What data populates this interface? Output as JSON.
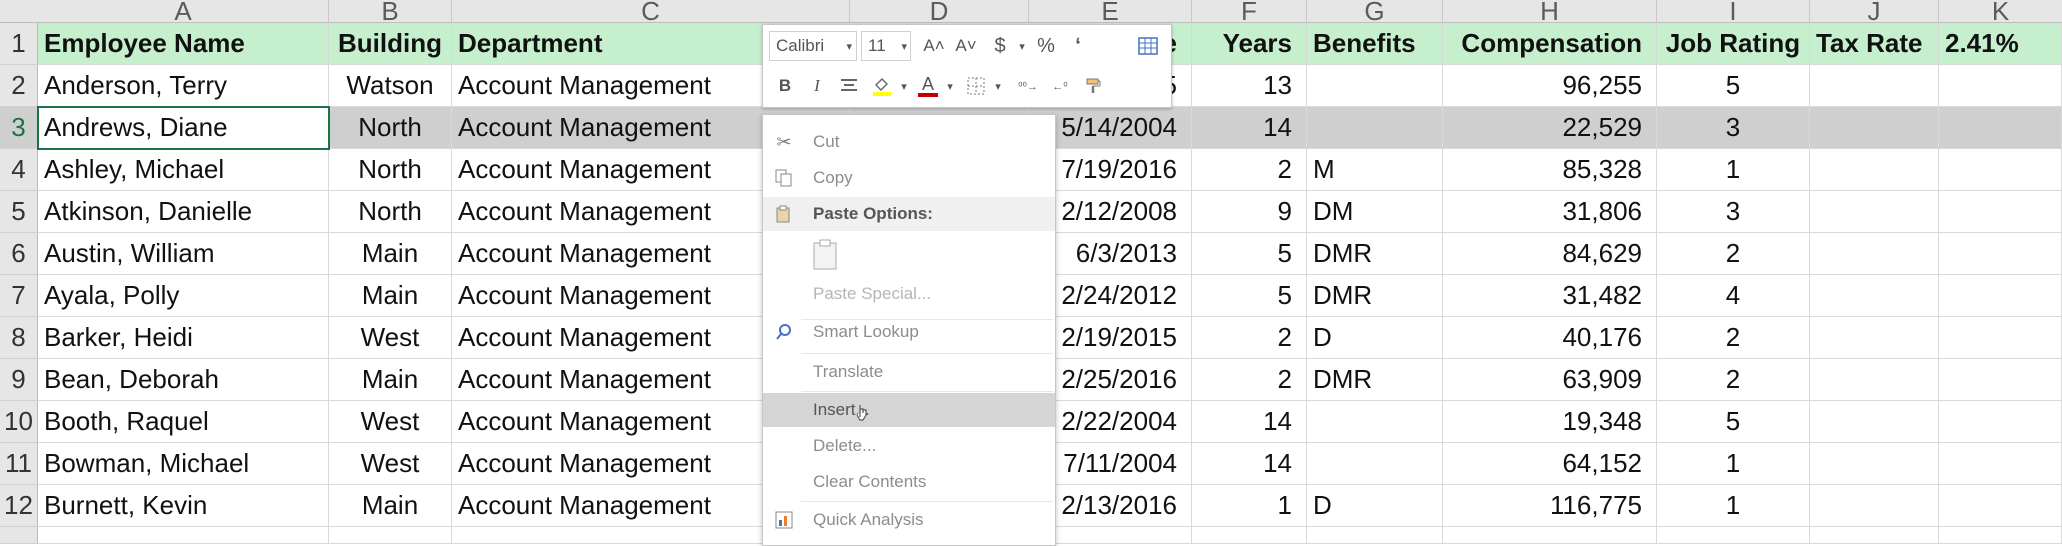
{
  "columns": [
    "A",
    "B",
    "C",
    "D",
    "E",
    "F",
    "G",
    "H",
    "I",
    "J",
    "K"
  ],
  "rows": [
    "1",
    "2",
    "3",
    "4",
    "5",
    "6",
    "7",
    "8",
    "9",
    "10",
    "11",
    "12"
  ],
  "header": {
    "employee_name": "Employee Name",
    "building": "Building",
    "department": "Department",
    "date_fragment": "e",
    "years": "Years",
    "benefits": "Benefits",
    "compensation": "Compensation",
    "job_rating": "Job Rating",
    "tax_rate_label": "Tax Rate",
    "tax_rate_value": "2.41%"
  },
  "data_rows": [
    {
      "name": "Anderson, Terry",
      "building": "Watson",
      "department": "Account Management",
      "date": "5",
      "years": "13",
      "benefits": "",
      "comp": "96,255",
      "rating": "5"
    },
    {
      "name": "Andrews, Diane",
      "building": "North",
      "department": "Account Management",
      "date": "5/14/2004",
      "years": "14",
      "benefits": "",
      "comp": "22,529",
      "rating": "3"
    },
    {
      "name": "Ashley, Michael",
      "building": "North",
      "department": "Account Management",
      "date": "7/19/2016",
      "years": "2",
      "benefits": "M",
      "comp": "85,328",
      "rating": "1"
    },
    {
      "name": "Atkinson, Danielle",
      "building": "North",
      "department": "Account Management",
      "date": "2/12/2008",
      "years": "9",
      "benefits": "DM",
      "comp": "31,806",
      "rating": "3"
    },
    {
      "name": "Austin, William",
      "building": "Main",
      "department": "Account Management",
      "date": "6/3/2013",
      "years": "5",
      "benefits": "DMR",
      "comp": "84,629",
      "rating": "2"
    },
    {
      "name": "Ayala, Polly",
      "building": "Main",
      "department": "Account Management",
      "date": "2/24/2012",
      "years": "5",
      "benefits": "DMR",
      "comp": "31,482",
      "rating": "4"
    },
    {
      "name": "Barker, Heidi",
      "building": "West",
      "department": "Account Management",
      "date": "2/19/2015",
      "years": "2",
      "benefits": "D",
      "comp": "40,176",
      "rating": "2"
    },
    {
      "name": "Bean, Deborah",
      "building": "Main",
      "department": "Account Management",
      "date": "2/25/2016",
      "years": "2",
      "benefits": "DMR",
      "comp": "63,909",
      "rating": "2"
    },
    {
      "name": "Booth, Raquel",
      "building": "West",
      "department": "Account Management",
      "date": "2/22/2004",
      "years": "14",
      "benefits": "",
      "comp": "19,348",
      "rating": "5"
    },
    {
      "name": "Bowman, Michael",
      "building": "West",
      "department": "Account Management",
      "date": "7/11/2004",
      "years": "14",
      "benefits": "",
      "comp": "64,152",
      "rating": "1"
    },
    {
      "name": "Burnett, Kevin",
      "building": "Main",
      "department": "Account Management",
      "date": "2/13/2016",
      "years": "1",
      "benefits": "D",
      "comp": "116,775",
      "rating": "1"
    }
  ],
  "mini_toolbar": {
    "font_name": "Calibri",
    "font_size": "11",
    "bold": "B",
    "italic": "I",
    "grow": "A˄",
    "shrink": "A˅",
    "currency": "$",
    "percent": "%",
    "comma": "ʻ",
    "font_color": "A"
  },
  "context_menu": {
    "cut": "Cut",
    "copy": "Copy",
    "paste_options": "Paste Options:",
    "paste_special": "Paste Special...",
    "smart_lookup": "Smart Lookup",
    "translate": "Translate",
    "insert": "Insert...",
    "delete": "Delete...",
    "clear_contents": "Clear Contents",
    "quick_analysis": "Quick Analysis"
  },
  "colors": {
    "header_fill": "#c6efce",
    "selected_row": "#cfcfcf",
    "active_border": "#1e7145",
    "font_color_bar": "#c00000",
    "fill_color_bar": "#ffff00"
  }
}
